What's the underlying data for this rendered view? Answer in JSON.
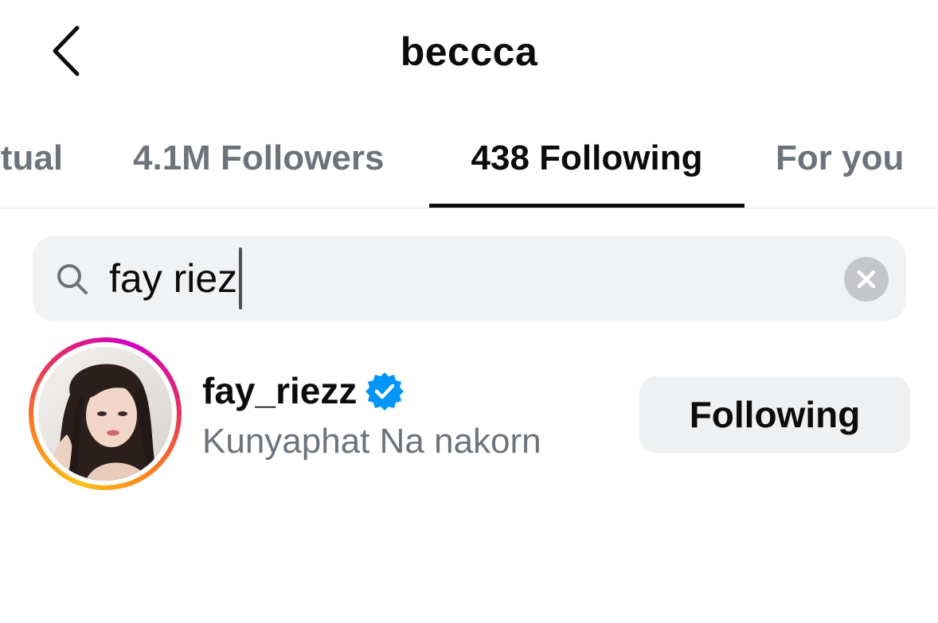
{
  "header": {
    "title": "beccca",
    "back_icon": "chevron-left-icon"
  },
  "tabs": [
    {
      "label": "utual",
      "active": false
    },
    {
      "label": "4.1M Followers",
      "active": false
    },
    {
      "label": "438 Following",
      "active": true
    },
    {
      "label": "For you",
      "active": false
    }
  ],
  "search": {
    "value": "fay riez",
    "icon": "search-icon",
    "clear_icon": "clear-icon"
  },
  "results": [
    {
      "username": "fay_riezz",
      "verified": true,
      "full_name": "Kunyaphat Na nakorn",
      "button_label": "Following",
      "has_story_ring": true
    }
  ],
  "colors": {
    "text_primary": "#0c0c0c",
    "text_secondary": "#6e737b",
    "search_bg": "#f1f2f4",
    "button_bg": "#eff0f2",
    "verified_blue": "#0095f6",
    "story_ring": [
      "#f9c11a",
      "#fa7e1e",
      "#e02a6b",
      "#d300c5"
    ]
  }
}
